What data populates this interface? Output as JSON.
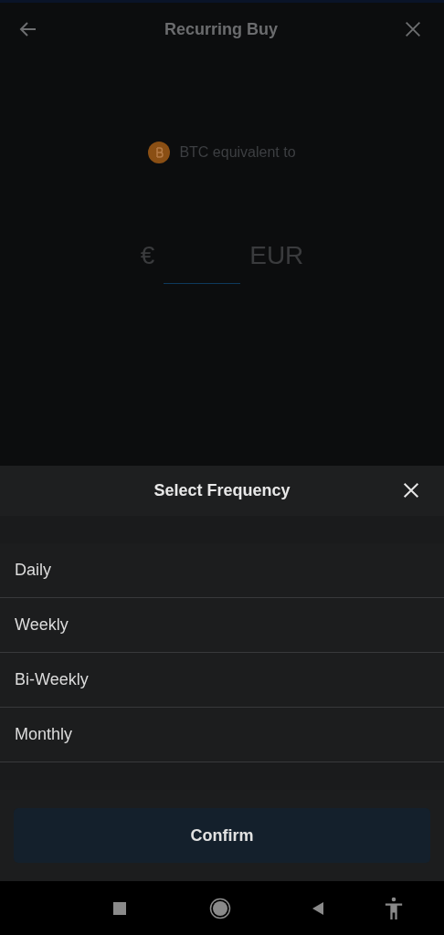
{
  "header": {
    "title": "Recurring Buy"
  },
  "asset": {
    "label": "BTC equivalent to"
  },
  "amount": {
    "currency_symbol": "€",
    "currency": "EUR"
  },
  "sheet": {
    "title": "Select Frequency",
    "options": [
      {
        "label": "Daily"
      },
      {
        "label": "Weekly"
      },
      {
        "label": "Bi-Weekly"
      },
      {
        "label": "Monthly"
      }
    ],
    "confirm": "Confirm"
  }
}
